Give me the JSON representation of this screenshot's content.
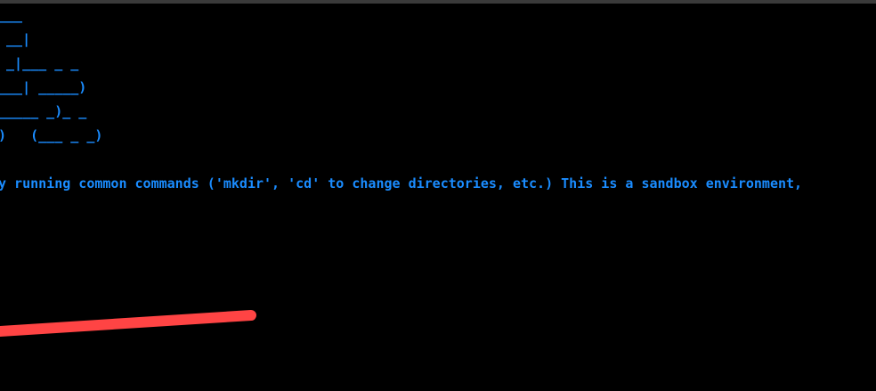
{
  "terminal": {
    "ascii_art": [
      "___",
      " __|",
      " _|___ _ _",
      "___| _____)",
      "_____ _)_ _",
      ")   (___ _ _)"
    ],
    "message": "y running common commands ('mkdir', 'cd' to change directories, etc.) This is a sandbox environment,",
    "text_color": "#1a8cff",
    "background_color": "#000000"
  },
  "annotation": {
    "type": "red-underline-stroke",
    "color": "#ff4444"
  }
}
